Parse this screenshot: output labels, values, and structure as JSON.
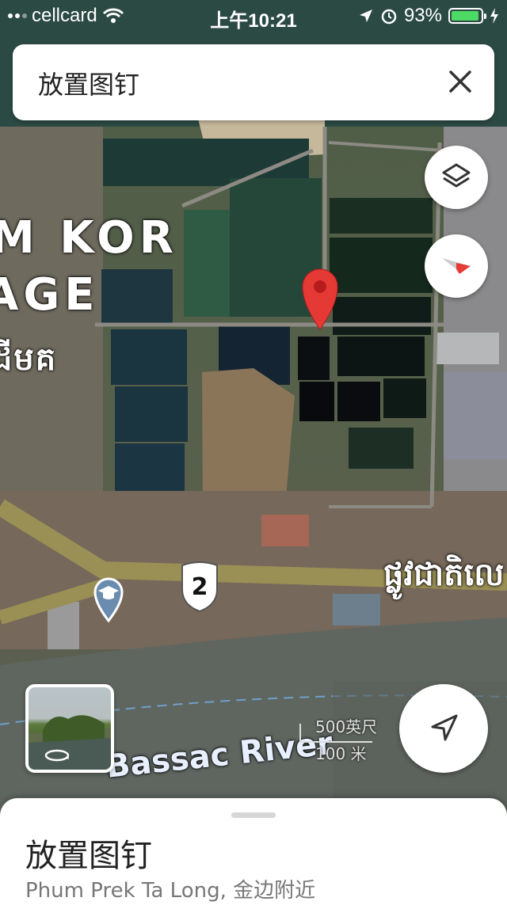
{
  "status_bar": {
    "carrier": "cellcard",
    "time": "上午10:21",
    "battery_percent": "93%",
    "battery_level": 0.93,
    "icons": [
      "signal-dots-icon",
      "wifi-icon",
      "location-arrow-icon",
      "alarm-icon",
      "battery-icon",
      "charging-bolt-icon"
    ]
  },
  "search_card": {
    "title": "放置图钉",
    "close_icon": "close-icon"
  },
  "map": {
    "place_label_line1": "M KOR",
    "place_label_line2": "AGE",
    "place_label_khmer": "ដីមគ",
    "road_label_khmer": "ផ្លូវជាតិលេ",
    "route_number": "2",
    "river_label": "Bassac River",
    "scale_imperial": "500英尺",
    "scale_metric": "100 米",
    "pin_color": "#e53935",
    "school_pin_color": "#6a8caf"
  },
  "controls": {
    "layers_icon": "layers-icon",
    "compass_icon": "compass-icon",
    "locate_icon": "navigation-arrow-icon",
    "street_view_icon": "rotate-360-icon"
  },
  "bottom_sheet": {
    "title": "放置图钉",
    "subtitle": "Phum Prek Ta Long, 金边附近"
  }
}
